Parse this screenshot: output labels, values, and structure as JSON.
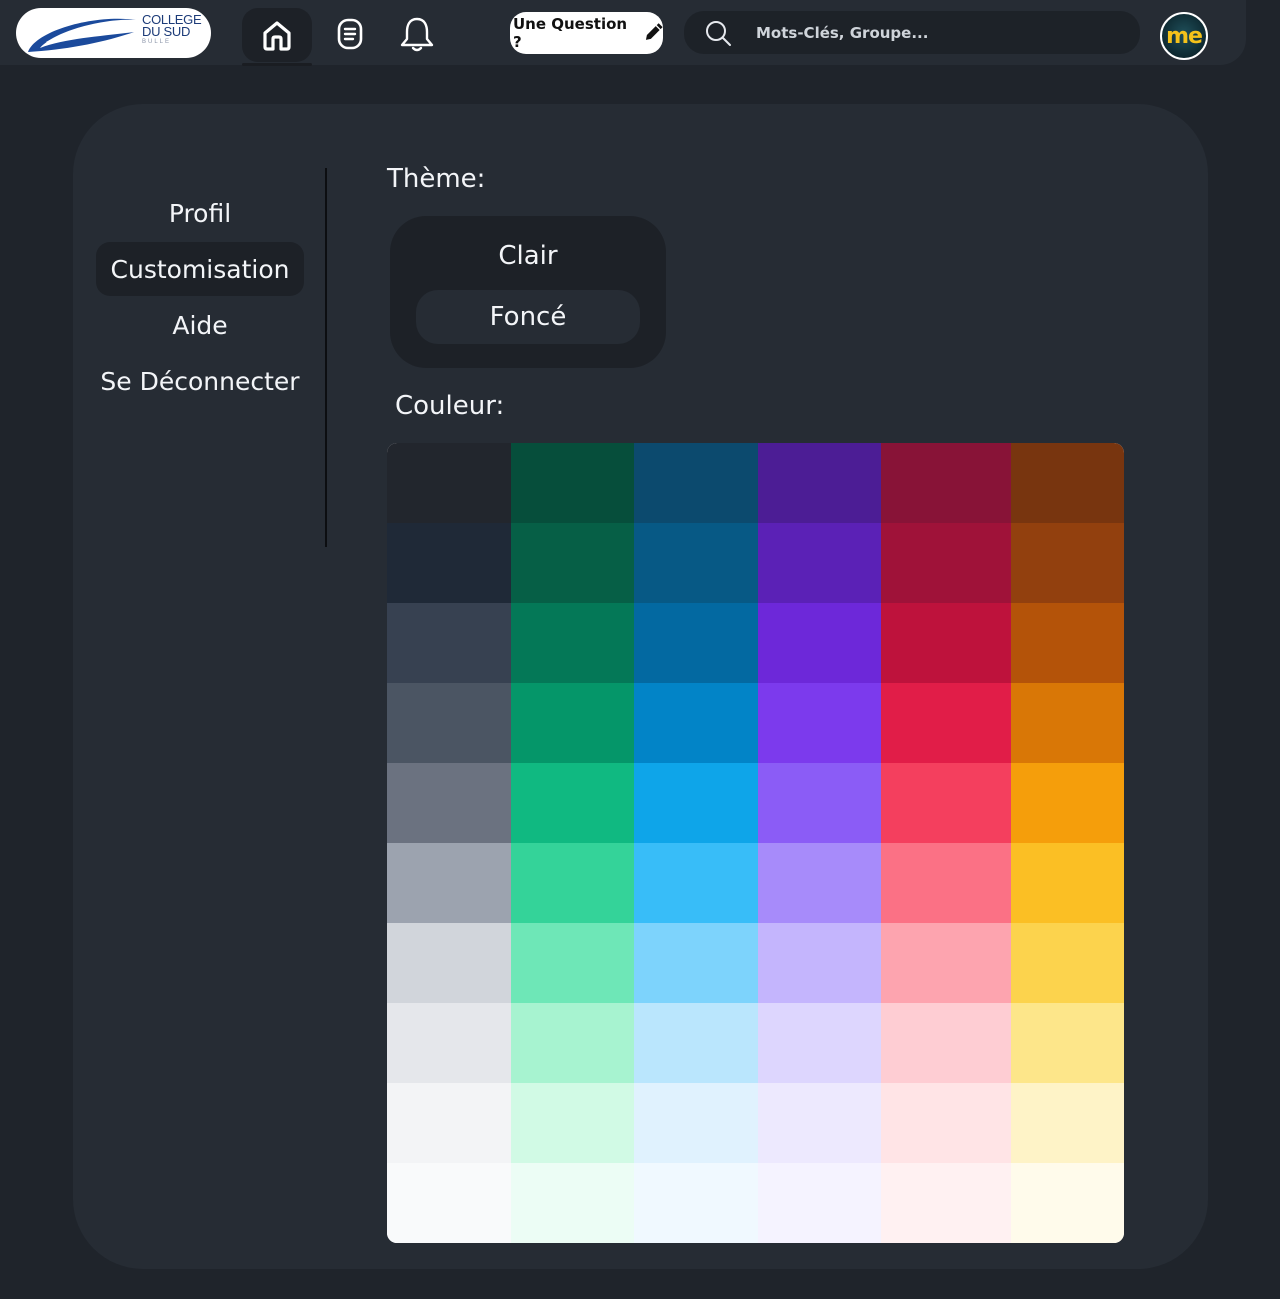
{
  "header": {
    "logo": {
      "line1": "COLLEGE",
      "line2": "DU SUD",
      "line3": "BULLE"
    },
    "question_button": "Une Question ?",
    "search_placeholder": "Mots-Clés, Groupe...",
    "avatar_text": "me"
  },
  "sidebar": {
    "items": [
      {
        "label": "Profil",
        "active": false
      },
      {
        "label": "Customisation",
        "active": true
      },
      {
        "label": "Aide",
        "active": false
      },
      {
        "label": "Se Déconnecter",
        "active": false
      }
    ]
  },
  "settings": {
    "theme_title": "Thème:",
    "theme_options": [
      {
        "label": "Clair",
        "selected": false
      },
      {
        "label": "Foncé",
        "selected": true
      }
    ],
    "color_title": "Couleur:"
  },
  "palette": {
    "columns": [
      {
        "name": "gray",
        "shades": [
          "#22262d",
          "#1f2937",
          "#374151",
          "#4b5563",
          "#6b7280",
          "#9ca3af",
          "#d1d5db",
          "#e5e7eb",
          "#f3f4f6",
          "#f9fafb"
        ]
      },
      {
        "name": "emerald",
        "shades": [
          "#064e3b",
          "#065f46",
          "#047857",
          "#059669",
          "#10b981",
          "#34d399",
          "#6ee7b7",
          "#a7f3d0",
          "#d1fae5",
          "#ecfdf5"
        ]
      },
      {
        "name": "sky",
        "shades": [
          "#0c4a6e",
          "#075985",
          "#0369a1",
          "#0284c7",
          "#0ea5e9",
          "#38bdf8",
          "#7dd3fc",
          "#bae6fd",
          "#e0f2fe",
          "#f0f9ff"
        ]
      },
      {
        "name": "violet",
        "shades": [
          "#4c1d95",
          "#5b21b6",
          "#6d28d9",
          "#7c3aed",
          "#8b5cf6",
          "#a78bfa",
          "#c4b5fd",
          "#ddd6fe",
          "#ede9fe",
          "#f5f3ff"
        ]
      },
      {
        "name": "rose",
        "shades": [
          "#881337",
          "#9f1239",
          "#be123c",
          "#e11d48",
          "#f43f5e",
          "#fb7185",
          "#fda4af",
          "#fecdd3",
          "#ffe4e6",
          "#fff1f2"
        ]
      },
      {
        "name": "amber",
        "shades": [
          "#78350f",
          "#92400e",
          "#b45309",
          "#d97706",
          "#f59e0b",
          "#fbbf24",
          "#fcd34d",
          "#fde68a",
          "#fef3c7",
          "#fffbeb"
        ]
      }
    ]
  }
}
